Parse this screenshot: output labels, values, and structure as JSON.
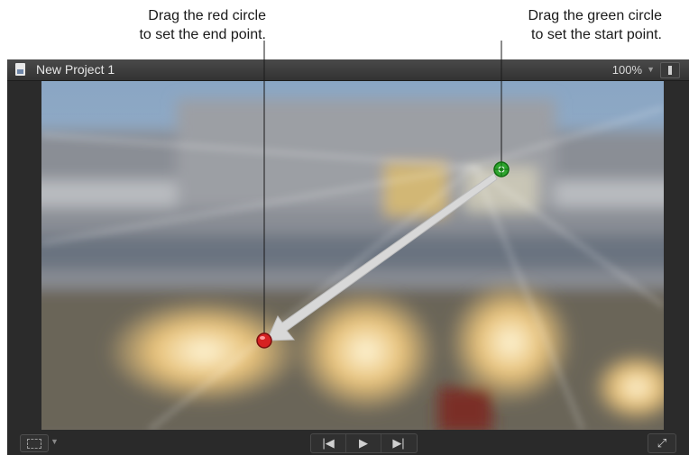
{
  "callouts": {
    "end_point": [
      "Drag the red circle",
      "to set the end point."
    ],
    "start_point": [
      "Drag the green circle",
      "to set the start point."
    ]
  },
  "viewer": {
    "project_name": "New Project 1",
    "zoom_level": "100%"
  },
  "icons": {
    "document": "document-icon",
    "zoom_menu": "chevron-down-icon",
    "view_options": "view-options-icon",
    "transform": "transform-icon",
    "go_to_start": "skip-back-icon",
    "play": "play-icon",
    "go_to_end": "skip-forward-icon",
    "fullscreen": "fullscreen-icon",
    "end_handle": "red-circle-handle",
    "start_handle": "green-circle-handle"
  },
  "colors": {
    "start_handle": "#2ea52e",
    "end_handle": "#d62222",
    "viewer_background": "#2b2b2b"
  }
}
